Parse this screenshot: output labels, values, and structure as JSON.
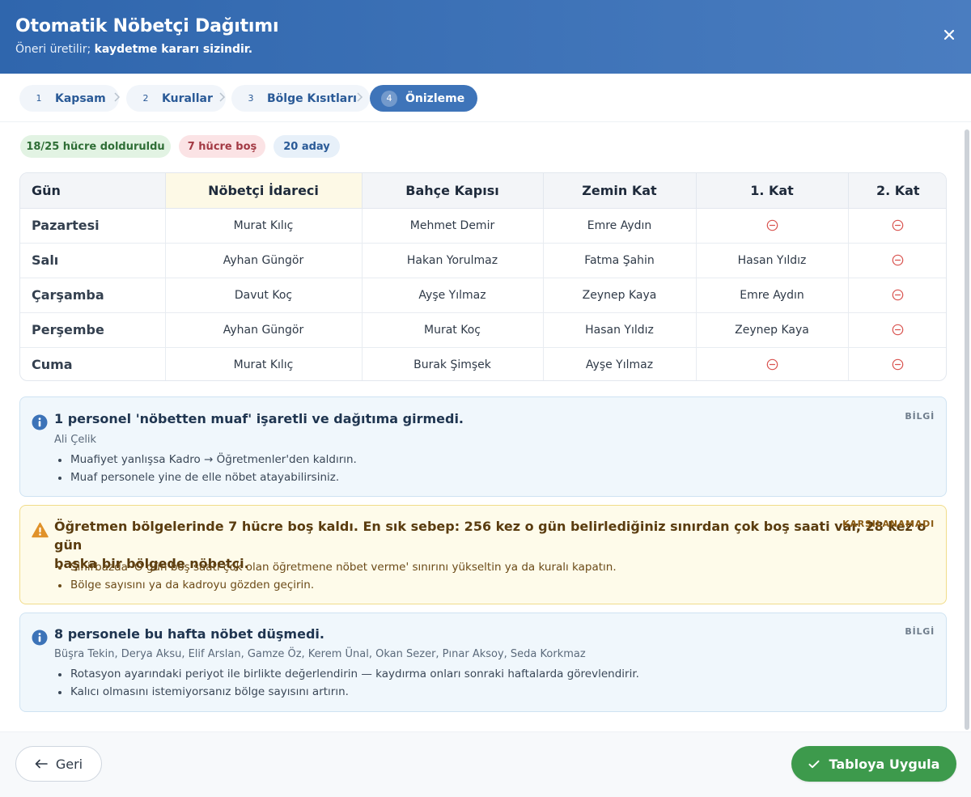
{
  "dialog": {
    "title": "Otomatik Nöbetçi Dağıtımı",
    "subtitle_prefix": "Öneri üretilir; ",
    "subtitle_bold": "kaydetme kararı sizindir.",
    "close_icon": "close-icon"
  },
  "steps": [
    {
      "num": "1",
      "label": "Kapsam",
      "active": false
    },
    {
      "num": "2",
      "label": "Kurallar",
      "active": false
    },
    {
      "num": "3",
      "label": "Bölge Kısıtları",
      "active": false
    },
    {
      "num": "4",
      "label": "Önizleme",
      "active": true
    }
  ],
  "summary": {
    "filled": "18/25 hücre dolduruldu",
    "empty": "7 hücre boş",
    "candidates": "20 aday"
  },
  "table": {
    "headers": [
      "Gün",
      "Nöbetçi İdareci",
      "Bahçe Kapısı",
      "Zemin Kat",
      "1. Kat",
      "2. Kat"
    ],
    "empty_icon": "minus-circle-icon",
    "rows": [
      {
        "day": "Pazartesi",
        "cells": [
          "Murat Kılıç",
          "Mehmet Demir",
          "Emre Aydın",
          "",
          ""
        ]
      },
      {
        "day": "Salı",
        "cells": [
          "Ayhan Güngör",
          "Hakan Yorulmaz",
          "Fatma Şahin",
          "Hasan Yıldız",
          ""
        ]
      },
      {
        "day": "Çarşamba",
        "cells": [
          "Davut Koç",
          "Ayşe Yılmaz",
          "Zeynep Kaya",
          "Emre Aydın",
          ""
        ]
      },
      {
        "day": "Perşembe",
        "cells": [
          "Ayhan Güngör",
          "Murat Koç",
          "Hasan Yıldız",
          "Zeynep Kaya",
          ""
        ]
      },
      {
        "day": "Cuma",
        "cells": [
          "Murat Kılıç",
          "Burak Şimşek",
          "Ayşe Yılmaz",
          "",
          ""
        ]
      }
    ]
  },
  "notices": [
    {
      "type": "info",
      "icon": "info-icon",
      "title": "1 personel 'nöbetten muaf' işaretli ve dağıtıma girmedi.",
      "badge": "BİLGİ",
      "names": "Ali Çelik",
      "bullets": [
        "Muafiyet yanlışsa Kadro → Öğretmenler'den kaldırın.",
        "Muaf personele yine de elle nöbet atayabilirsiniz."
      ]
    },
    {
      "type": "warn",
      "icon": "warning-icon",
      "title_line1": "Öğretmen bölgelerinde 7 hücre boş kaldı. En sık sebep: 256 kez o gün belirlediğiniz sınırdan çok boş saati var, 28 kez o gün",
      "title_line2": "başka bir bölgede nöbetçi.",
      "badge": "KARŞILANAMADI",
      "bullets": [
        "Sihirbazda 'O gün boş saati çok olan öğretmene nöbet verme' sınırını yükseltin ya da kuralı kapatın.",
        "Bölge sayısını ya da kadroyu gözden geçirin."
      ]
    },
    {
      "type": "info",
      "icon": "info-icon",
      "title": "8 personele bu hafta nöbet düşmedi.",
      "badge": "BİLGİ",
      "names": "Büşra Tekin, Derya Aksu, Elif Arslan, Gamze Öz, Kerem Ünal, Okan Sezer, Pınar Aksoy, Seda Korkmaz",
      "bullets": [
        "Rotasyon ayarındaki periyot ile birlikte değerlendirin — kaydırma onları sonraki haftalarda görevlendirir.",
        "Kalıcı olmasını istemiyorsanız bölge sayısını artırın."
      ]
    }
  ],
  "footer": {
    "back_label": "Geri",
    "apply_label": "Tabloya Uygula"
  },
  "colors": {
    "header": "#3a70b5",
    "active_step": "#3e74b9",
    "apply": "#3d9a4c",
    "empty_cell": "#d9534f"
  }
}
